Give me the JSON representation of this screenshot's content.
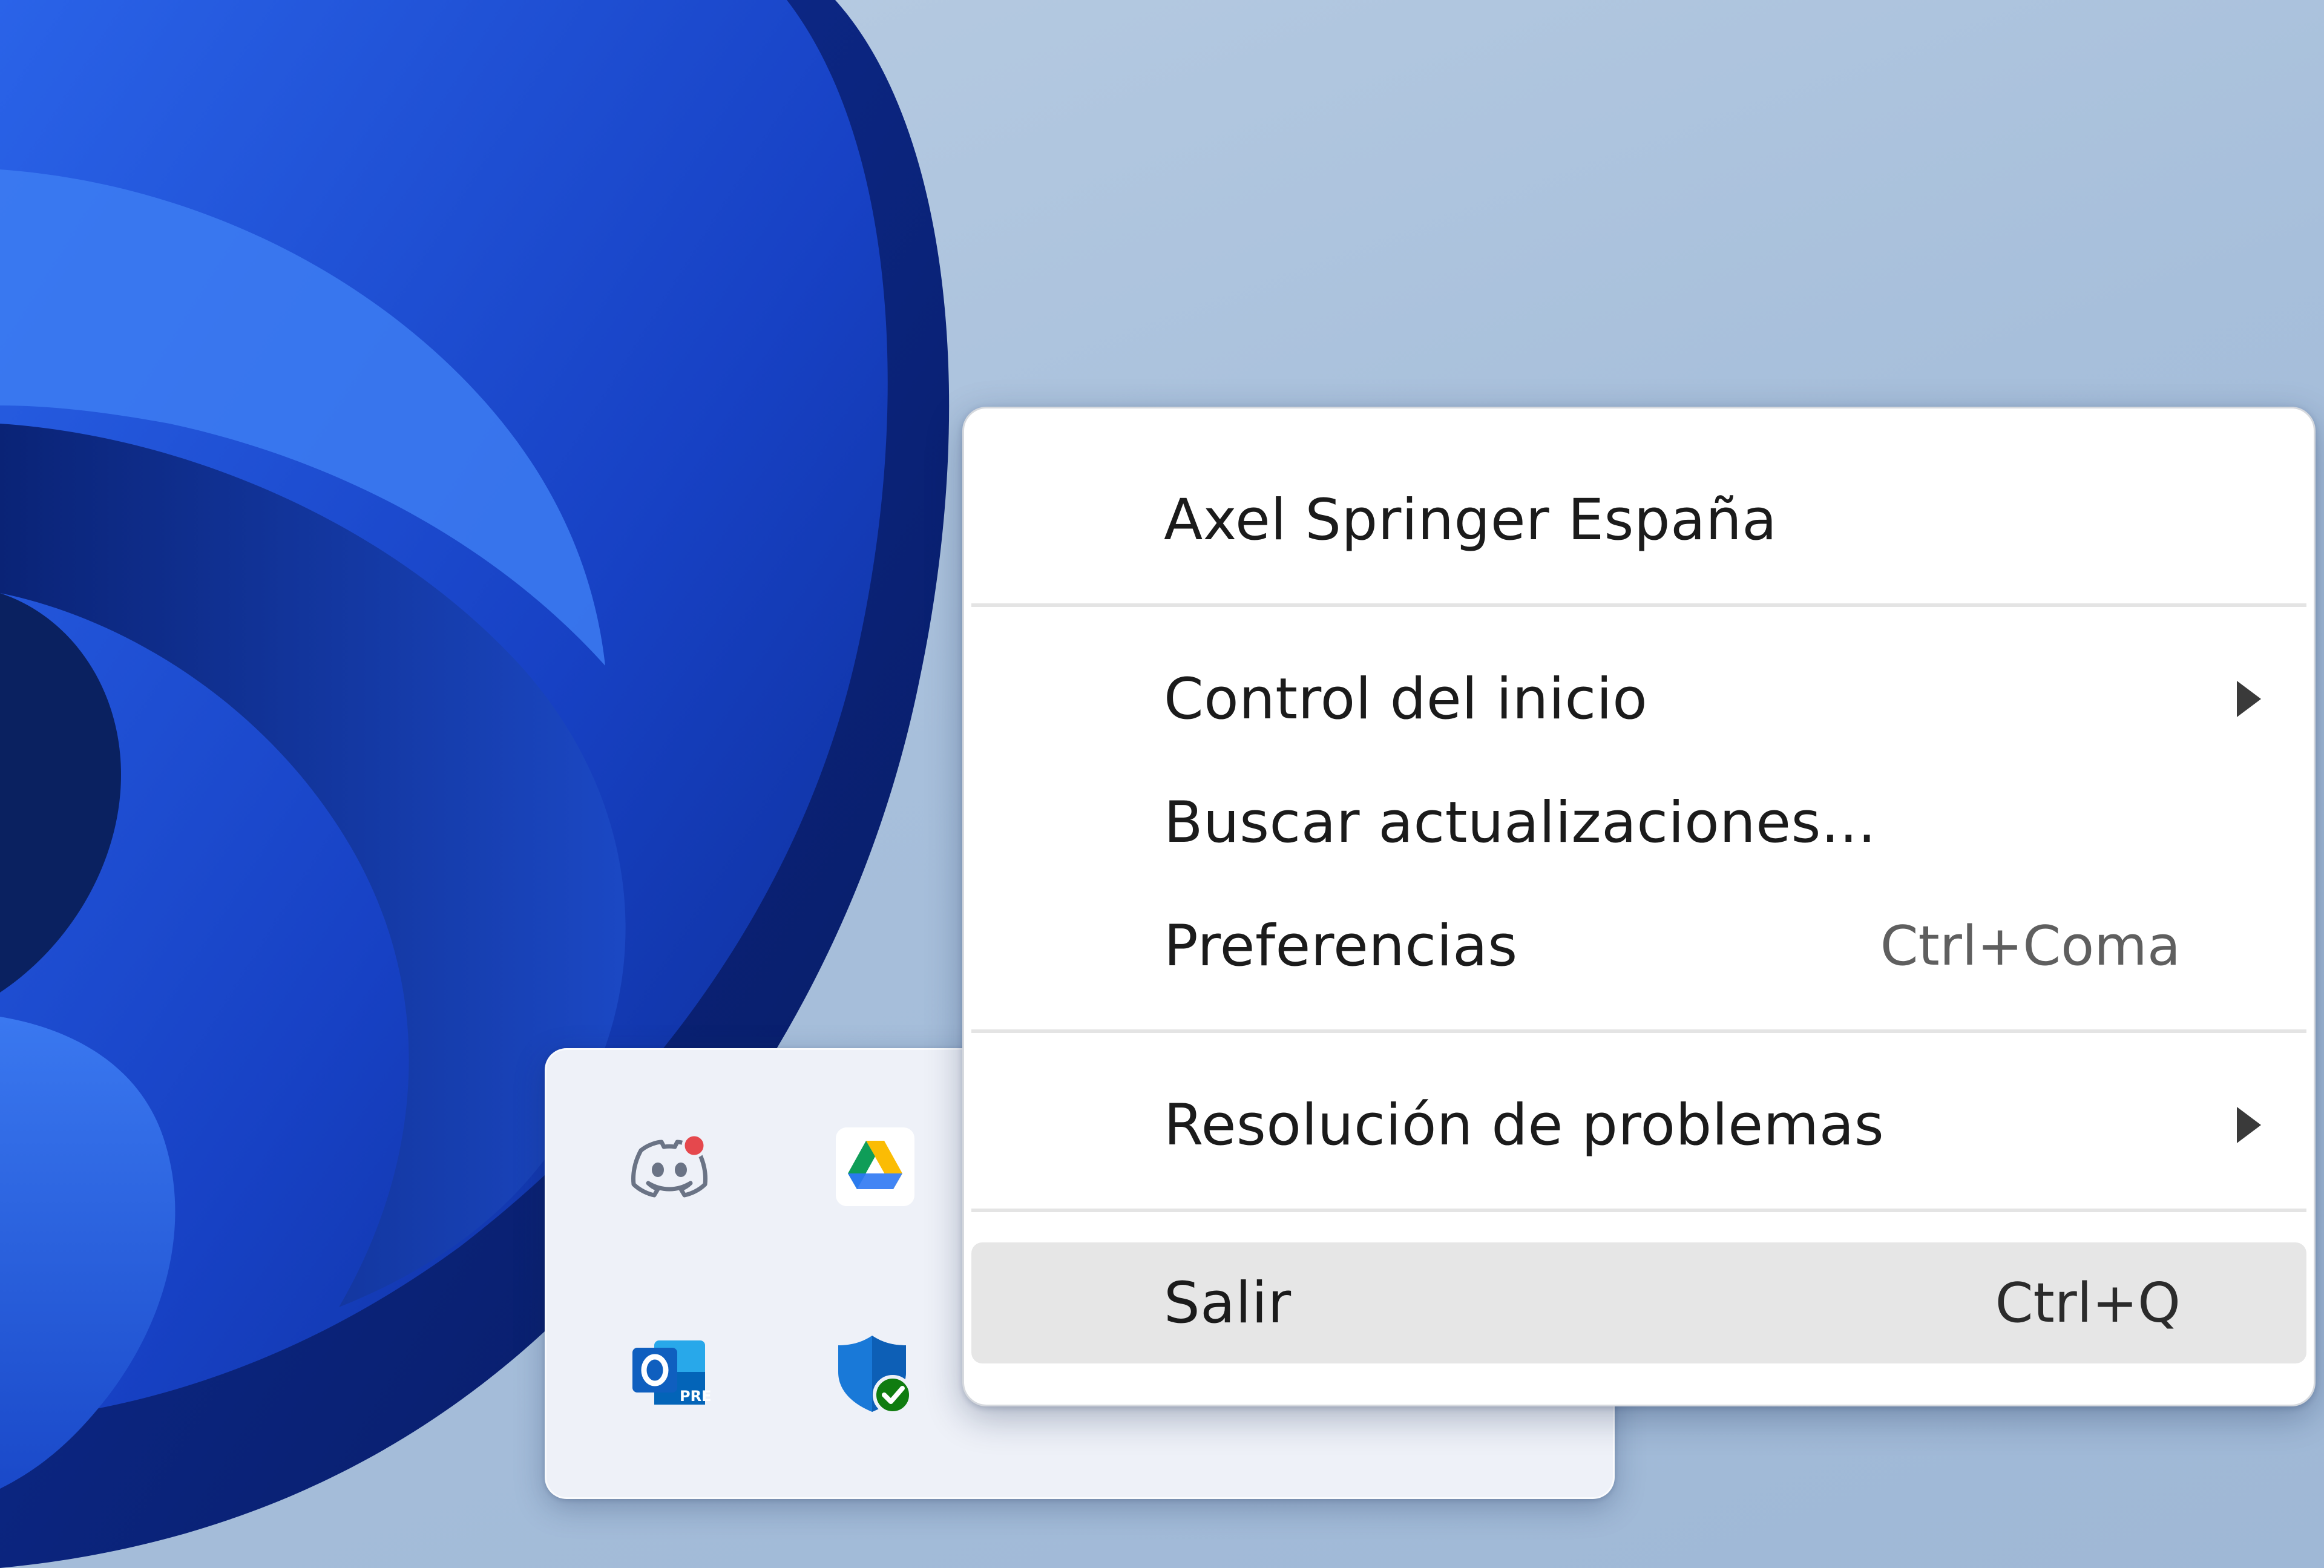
{
  "context_menu": {
    "header": "Axel Springer España",
    "items": [
      {
        "label": "Control del inicio",
        "shortcut": "",
        "submenu": true
      },
      {
        "label": "Buscar actualizaciones...",
        "shortcut": "",
        "submenu": false
      },
      {
        "label": "Preferencias",
        "shortcut": "Ctrl+Coma",
        "submenu": false
      },
      {
        "label": "Resolución de problemas",
        "shortcut": "",
        "submenu": true
      },
      {
        "label": "Salir",
        "shortcut": "Ctrl+Q",
        "submenu": false,
        "highlighted": true
      }
    ]
  },
  "tray_flyout": {
    "icons": [
      {
        "name": "discord-icon",
        "badge": true
      },
      {
        "name": "google-drive-icon"
      },
      {
        "name": "outlook-icon",
        "caption": "PRE"
      },
      {
        "name": "windows-security-icon",
        "status": "ok"
      },
      {
        "name": "purple-app-icon"
      }
    ]
  },
  "colors": {
    "menu_background": "#ffffff",
    "menu_hover": "#e6e6e6",
    "desktop_background": "#a7bfdb",
    "wallpaper_blue": "#1a47c7"
  }
}
